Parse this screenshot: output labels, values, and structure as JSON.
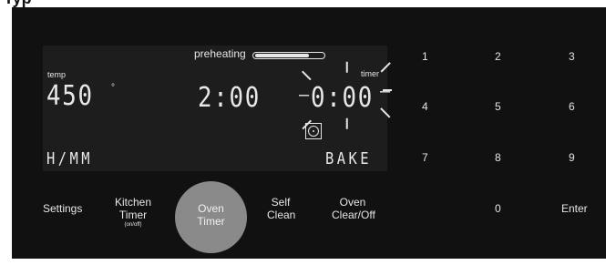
{
  "header": {
    "partial_title": "Typ"
  },
  "display": {
    "preheating_label": "preheating",
    "preheat_progress": 0.8,
    "temp_label": "temp",
    "temp_value": "450",
    "degree_symbol": "°",
    "time_value": "2:00",
    "timer_label": "timer",
    "timer_dash_left": "–",
    "timer_value": "0:00",
    "timer_dash_right": "–",
    "clock_format": "H/MM",
    "mode": "BAKE",
    "fan_icon": "convection-fan-icon"
  },
  "keypad": {
    "keys": [
      "1",
      "2",
      "3",
      "4",
      "5",
      "6",
      "7",
      "8",
      "9",
      "0",
      "Enter"
    ]
  },
  "buttons": {
    "settings": "Settings",
    "kitchen_timer_line1": "Kitchen",
    "kitchen_timer_line2": "Timer",
    "kitchen_timer_sub": "(on/off)",
    "oven_timer_line1": "Oven",
    "oven_timer_line2": "Timer",
    "self_clean_line1": "Self",
    "self_clean_line2": "Clean",
    "oven_clear_line1": "Oven",
    "oven_clear_line2": "Clear/Off"
  },
  "colors": {
    "panel": "#111111",
    "lcd": "#1d1d1d",
    "text": "#e6e6e6",
    "oven_timer_active": "#8a8a8a"
  }
}
